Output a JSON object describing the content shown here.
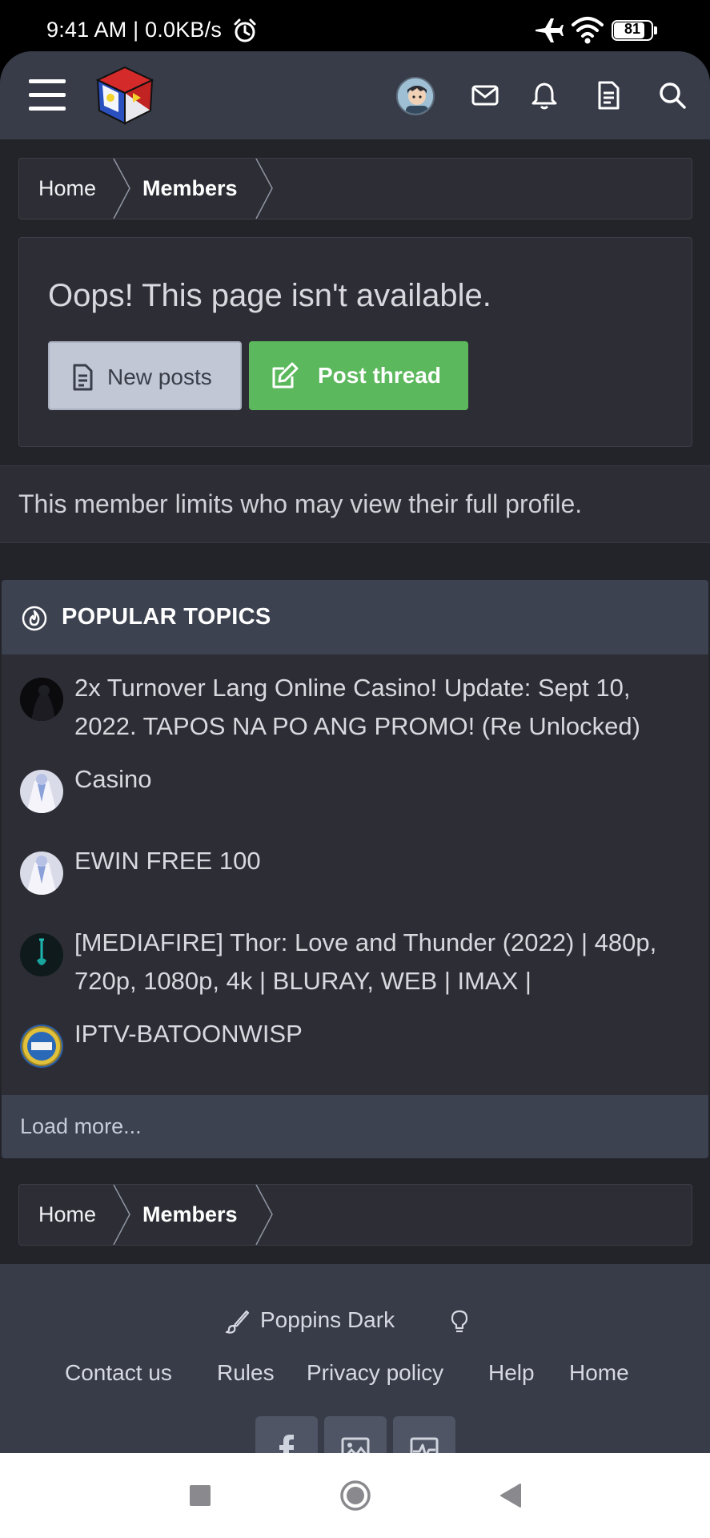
{
  "status_bar": {
    "time": "9:41 AM | 0.0KB/s",
    "battery_level": "81",
    "icons": [
      "alarm-icon",
      "airplane-icon",
      "wifi-icon",
      "battery-icon"
    ]
  },
  "header": {
    "icons": [
      "menu-icon",
      "site-logo",
      "avatar",
      "mail-icon",
      "bell-icon",
      "document-icon",
      "search-icon"
    ]
  },
  "breadcrumb": {
    "home": "Home",
    "members": "Members"
  },
  "error": {
    "title": "Oops! This page isn't available.",
    "new_posts": "New posts",
    "post_thread": "Post thread",
    "message": "This member limits who may view their full profile."
  },
  "popular_topics": {
    "title": "POPULAR TOPICS",
    "items": [
      {
        "title": "2x Turnover Lang Online Casino! Update: Sept 10, 2022. TAPOS NA PO ANG PROMO! (Re Unlocked)"
      },
      {
        "title": "Casino"
      },
      {
        "title": "EWIN FREE 100"
      },
      {
        "title": "[MEDIAFIRE] Thor: Love and Thunder (2022) | 480p, 720p, 1080p, 4k | BLURAY, WEB | IMAX |"
      },
      {
        "title": "IPTV-BATOONWISP"
      }
    ],
    "load_more": "Load more..."
  },
  "footer": {
    "style_name": "Poppins Dark",
    "links": [
      "Contact us",
      "Rules",
      "Privacy policy",
      "Help",
      "Home"
    ]
  },
  "colors": {
    "accent_green": "#5cb85c",
    "header_bg": "#373c48",
    "page_bg": "#232429"
  }
}
